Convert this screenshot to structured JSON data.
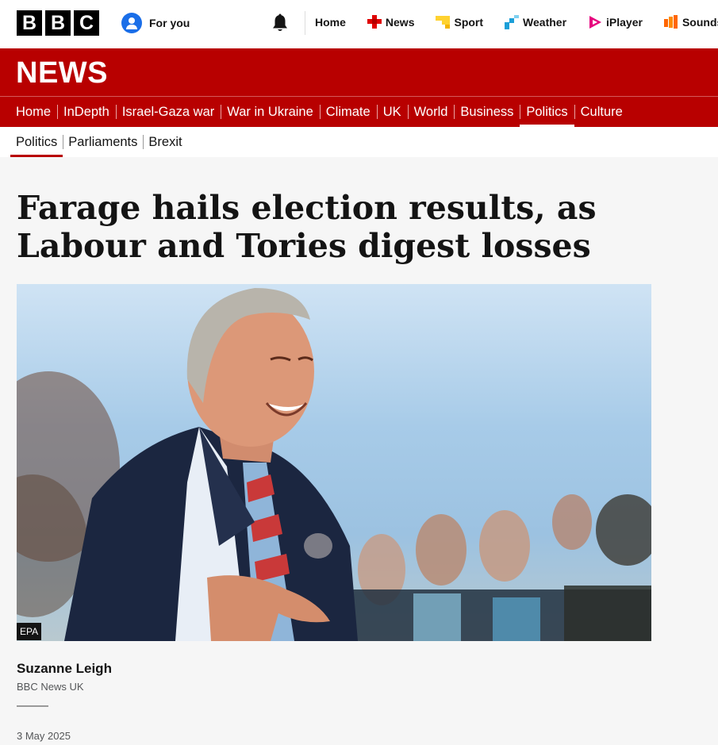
{
  "brand": {
    "letters": [
      "B",
      "B",
      "C"
    ]
  },
  "top": {
    "for_you": "For you",
    "nav": [
      {
        "label": "Home",
        "icon": "home",
        "color": "#000000"
      },
      {
        "label": "News",
        "icon": "news-icon",
        "color": "#e00000"
      },
      {
        "label": "Sport",
        "icon": "sport-icon",
        "color": "#ffd230"
      },
      {
        "label": "Weather",
        "icon": "weather-icon",
        "color": "#1b9fd8"
      },
      {
        "label": "iPlayer",
        "icon": "iplayer-icon",
        "color": "#e6007e"
      },
      {
        "label": "Sounds",
        "icon": "sounds-icon",
        "color": "#ff6600"
      }
    ]
  },
  "banner": {
    "title": "NEWS",
    "color": "#b80000"
  },
  "nav": {
    "items": [
      "Home",
      "InDepth",
      "Israel-Gaza war",
      "War in Ukraine",
      "Climate",
      "UK",
      "World",
      "Business",
      "Politics",
      "Culture"
    ],
    "active": "Politics"
  },
  "subnav": {
    "items": [
      "Politics",
      "Parliaments",
      "Brexit"
    ],
    "active": "Politics"
  },
  "article": {
    "headline": "Farage hails election results, as Labour and Tories digest losses",
    "image_credit": "EPA",
    "author": "Suzanne Leigh",
    "source": "BBC News UK",
    "date": "3 May 2025"
  }
}
